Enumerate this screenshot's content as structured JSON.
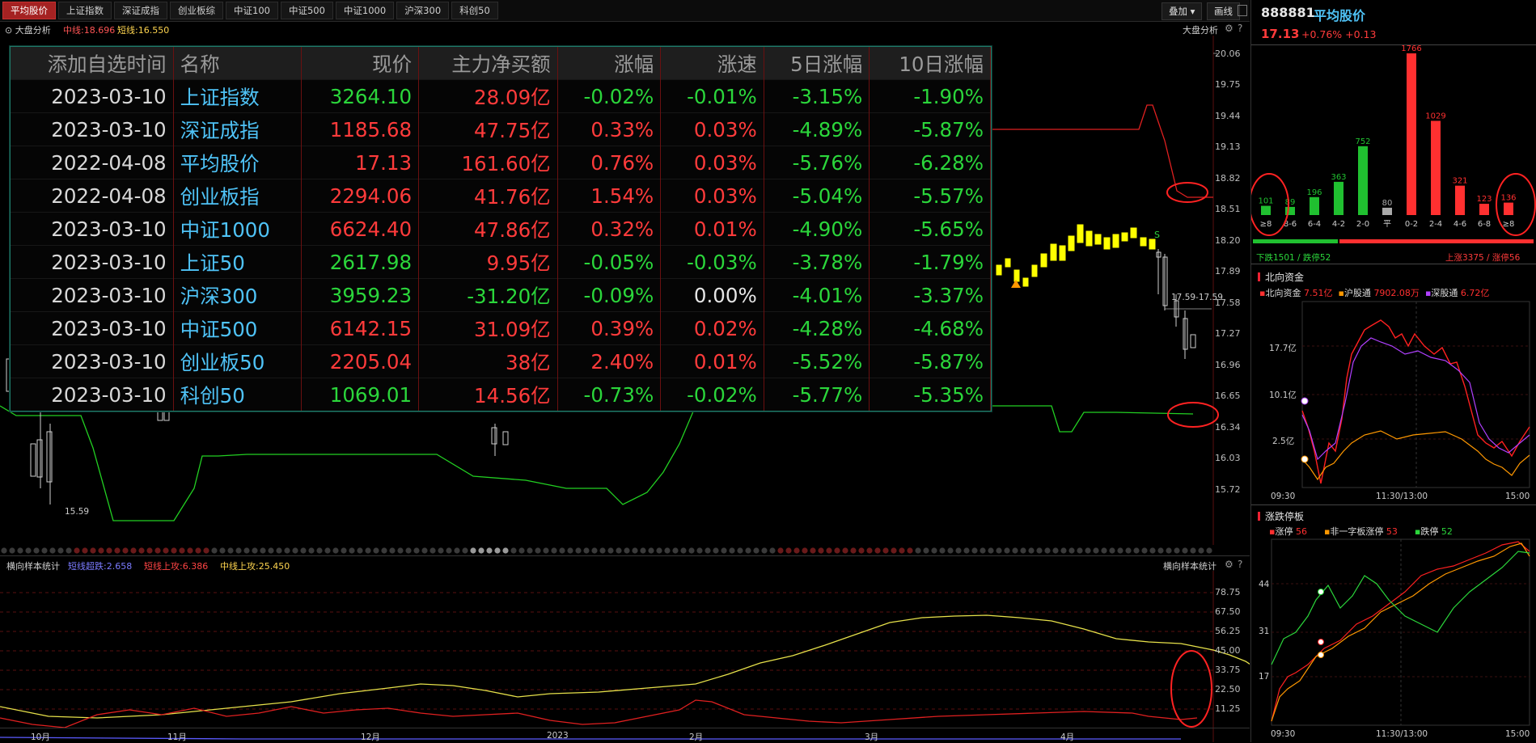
{
  "tabs": [
    "平均股价",
    "上证指数",
    "深证成指",
    "创业板综",
    "中证100",
    "中证500",
    "中证1000",
    "沪深300",
    "科创50"
  ],
  "toolbar": {
    "overlay": "叠加",
    "draw": "画线"
  },
  "main": {
    "indicator": "大盘分析",
    "mid_line_label": "中线:18.696",
    "short_line_label": "短线:16.550",
    "indicator_right": "大盘分析",
    "low_label": "15.59",
    "range_label": "17.59-17.59",
    "y_ticks": [
      "20.06",
      "19.75",
      "19.44",
      "19.13",
      "18.82",
      "18.51",
      "18.20",
      "17.89",
      "17.58",
      "17.27",
      "16.96",
      "16.65",
      "16.34",
      "16.03",
      "15.72"
    ]
  },
  "table": {
    "headers": [
      "添加自选时间",
      "名称",
      "现价",
      "主力净买额",
      "涨幅",
      "涨速",
      "5日涨幅",
      "10日涨幅"
    ],
    "rows": [
      [
        "2023-03-10",
        "上证指数",
        "3264.10",
        "28.09亿",
        "-0.02%",
        "-0.01%",
        "-3.15%",
        "-1.90%"
      ],
      [
        "2023-03-10",
        "深证成指",
        "1185.68",
        "47.75亿",
        "0.33%",
        "0.03%",
        "-4.89%",
        "-5.87%"
      ],
      [
        "2022-04-08",
        "平均股价",
        "17.13",
        "161.60亿",
        "0.76%",
        "0.03%",
        "-5.76%",
        "-6.28%"
      ],
      [
        "2022-04-08",
        "创业板指",
        "2294.06",
        "41.76亿",
        "1.54%",
        "0.03%",
        "-5.04%",
        "-5.57%"
      ],
      [
        "2023-03-10",
        "中证1000",
        "6624.40",
        "47.86亿",
        "0.32%",
        "0.01%",
        "-4.90%",
        "-5.65%"
      ],
      [
        "2023-03-10",
        "上证50",
        "2617.98",
        "9.95亿",
        "-0.05%",
        "-0.03%",
        "-3.78%",
        "-1.79%"
      ],
      [
        "2023-03-10",
        "沪深300",
        "3959.23",
        "-31.20亿",
        "-0.09%",
        "0.00%",
        "-4.01%",
        "-3.37%"
      ],
      [
        "2023-03-10",
        "中证500",
        "6142.15",
        "31.09亿",
        "0.39%",
        "0.02%",
        "-4.28%",
        "-4.68%"
      ],
      [
        "2023-03-10",
        "创业板50",
        "2205.04",
        "38亿",
        "2.40%",
        "0.01%",
        "-5.52%",
        "-5.87%"
      ],
      [
        "2023-03-10",
        "科创50",
        "1069.01",
        "14.56亿",
        "-0.73%",
        "-0.02%",
        "-5.77%",
        "-5.35%"
      ]
    ],
    "colors": {
      "red": "#ff3b3b",
      "green": "#2bd63b",
      "white": "#e6e6e6",
      "cyan": "#4fc3f7"
    }
  },
  "lower": {
    "title": "横向样本统计",
    "s1": "短线超跌:2.658",
    "s2": "短线上攻:6.386",
    "s3": "中线上攻:25.450",
    "title_right": "横向样本统计",
    "y_ticks": [
      "78.75",
      "67.50",
      "56.25",
      "45.00",
      "33.75",
      "22.50",
      "11.25"
    ],
    "x_ticks": [
      "10月",
      "11月",
      "12月",
      "2023",
      "2月",
      "3月",
      "4月"
    ]
  },
  "right": {
    "code": "888881",
    "name": "平均股价",
    "price": "17.13",
    "change": "+0.76% +0.13",
    "dist": {
      "values": [
        "101",
        "89",
        "196",
        "363",
        "752",
        "80",
        "1766",
        "1029",
        "321",
        "123",
        "136"
      ],
      "labels": [
        "≥8",
        "8-6",
        "6-4",
        "4-2",
        "2-0",
        "平",
        "0-2",
        "2-4",
        "4-6",
        "6-8",
        "≥8"
      ],
      "down": "下跌1501 / 跌停52",
      "up": "上涨3375 / 涨停56"
    },
    "north": {
      "title": "北向资金",
      "l1": "北向资金",
      "v1": "7.51亿",
      "l2": "沪股通",
      "v2": "7902.08万",
      "l3": "深股通",
      "v3": "6.72亿",
      "y": [
        "17.7亿",
        "10.1亿",
        "2.5亿"
      ],
      "x": [
        "09:30",
        "11:30/13:00",
        "15:00"
      ]
    },
    "limit": {
      "title": "涨跌停板",
      "l1": "涨停",
      "v1": "56",
      "l2": "非一字板涨停",
      "v2": "53",
      "l3": "跌停",
      "v3": "52",
      "y": [
        "44",
        "31",
        "17"
      ],
      "x": [
        "09:30",
        "11:30/13:00",
        "15:00"
      ]
    }
  }
}
